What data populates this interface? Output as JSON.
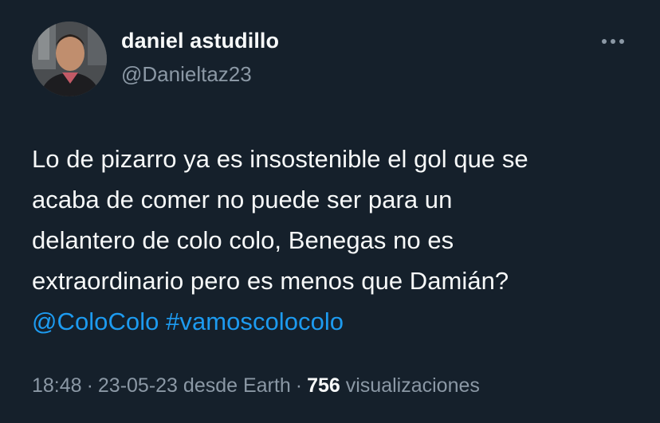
{
  "user": {
    "display_name": "daniel astudillo",
    "handle": "@Danieltaz23"
  },
  "tweet": {
    "line1": "Lo de pizarro ya es insostenible el gol que se",
    "line2": "acaba de comer no puede ser para un",
    "line3": "delantero de colo colo, Benegas no es",
    "line4": "extraordinario pero es menos que Damián?",
    "mention": "@ColoColo",
    "hashtag": "#vamoscolocolo"
  },
  "meta": {
    "time": "18:48",
    "date": "23-05-23",
    "source": "desde Earth",
    "views_count": "756",
    "views_label": "visualizaciones",
    "separator": "·"
  },
  "icons": {
    "more": "more-horizontal-icon"
  },
  "colors": {
    "background": "#15202b",
    "primary_text": "#f7f9f9",
    "secondary_text": "#8b98a5",
    "link": "#1d9bf0"
  }
}
